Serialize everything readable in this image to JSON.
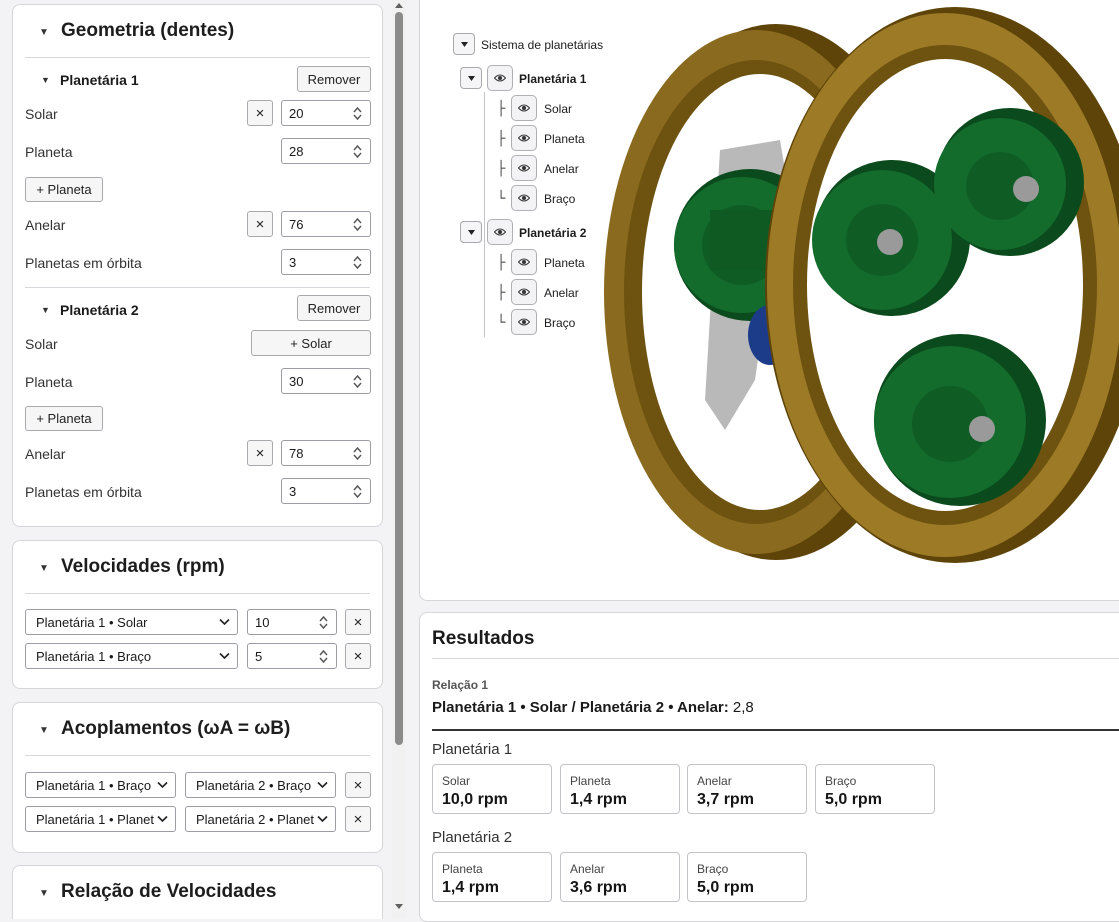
{
  "geometry": {
    "title": "Geometria (dentes)",
    "p1": {
      "title": "Planetária 1",
      "remove_label": "Remover",
      "sun_label": "Solar",
      "sun_value": "20",
      "planet_label": "Planeta",
      "planet_value": "28",
      "add_planet_label": "+ Planeta",
      "ring_label": "Anelar",
      "ring_value": "76",
      "orbit_label": "Planetas em órbita",
      "orbit_value": "3",
      "clear_label": "×"
    },
    "p2": {
      "title": "Planetária 2",
      "remove_label": "Remover",
      "sun_label": "Solar",
      "add_sun_label": "+ Solar",
      "planet_label": "Planeta",
      "planet_value": "30",
      "add_planet_label": "+ Planeta",
      "ring_label": "Anelar",
      "ring_value": "78",
      "orbit_label": "Planetas em órbita",
      "orbit_value": "3",
      "clear_label": "×"
    }
  },
  "speeds": {
    "title": "Velocidades (rpm)",
    "rows": [
      {
        "component": "Planetária 1 • Solar",
        "value": "10",
        "clear": "×"
      },
      {
        "component": "Planetária 1 • Braço",
        "value": "5",
        "clear": "×"
      }
    ]
  },
  "couplings": {
    "title": "Acoplamentos (ωA = ωB)",
    "rows": [
      {
        "a": "Planetária 1 • Braço",
        "b": "Planetária 2 • Braço",
        "clear": "×"
      },
      {
        "a": "Planetária 1 • Planet",
        "b": "Planetária 2 • Planet",
        "clear": "×"
      }
    ]
  },
  "ratio_panel": {
    "title": "Relação de Velocidades"
  },
  "tree": {
    "root": "Sistema de planetárias",
    "groups": [
      {
        "label": "Planetária 1",
        "children": [
          "Solar",
          "Planeta",
          "Anelar",
          "Braço"
        ]
      },
      {
        "label": "Planetária 2",
        "children": [
          "Planeta",
          "Anelar",
          "Braço"
        ]
      }
    ],
    "glyph_branch": "├",
    "glyph_last": "└"
  },
  "results": {
    "title": "Resultados",
    "relation_label": "Relação 1",
    "relation_expr": "Planetária 1 • Solar / Planetária 2 • Anelar:",
    "relation_value": "2,8",
    "groups": [
      {
        "title": "Planetária 1",
        "items": [
          {
            "label": "Solar",
            "value": "10,0 rpm"
          },
          {
            "label": "Planeta",
            "value": "1,4 rpm"
          },
          {
            "label": "Anelar",
            "value": "3,7 rpm"
          },
          {
            "label": "Braço",
            "value": "5,0 rpm"
          }
        ]
      },
      {
        "title": "Planetária 2",
        "items": [
          {
            "label": "Planeta",
            "value": "1,4 rpm"
          },
          {
            "label": "Anelar",
            "value": "3,6 rpm"
          },
          {
            "label": "Braço",
            "value": "5,0 rpm"
          }
        ]
      }
    ]
  },
  "colors": {
    "ring": "#7a5a12",
    "ring_face": "#9c7a26",
    "gear_green": "#136b2c",
    "gear_dark": "#0b4a1c",
    "shaft": "#9a9a9a",
    "carrier": "#b9b9b9",
    "sun_blue": "#1c3c8a"
  }
}
